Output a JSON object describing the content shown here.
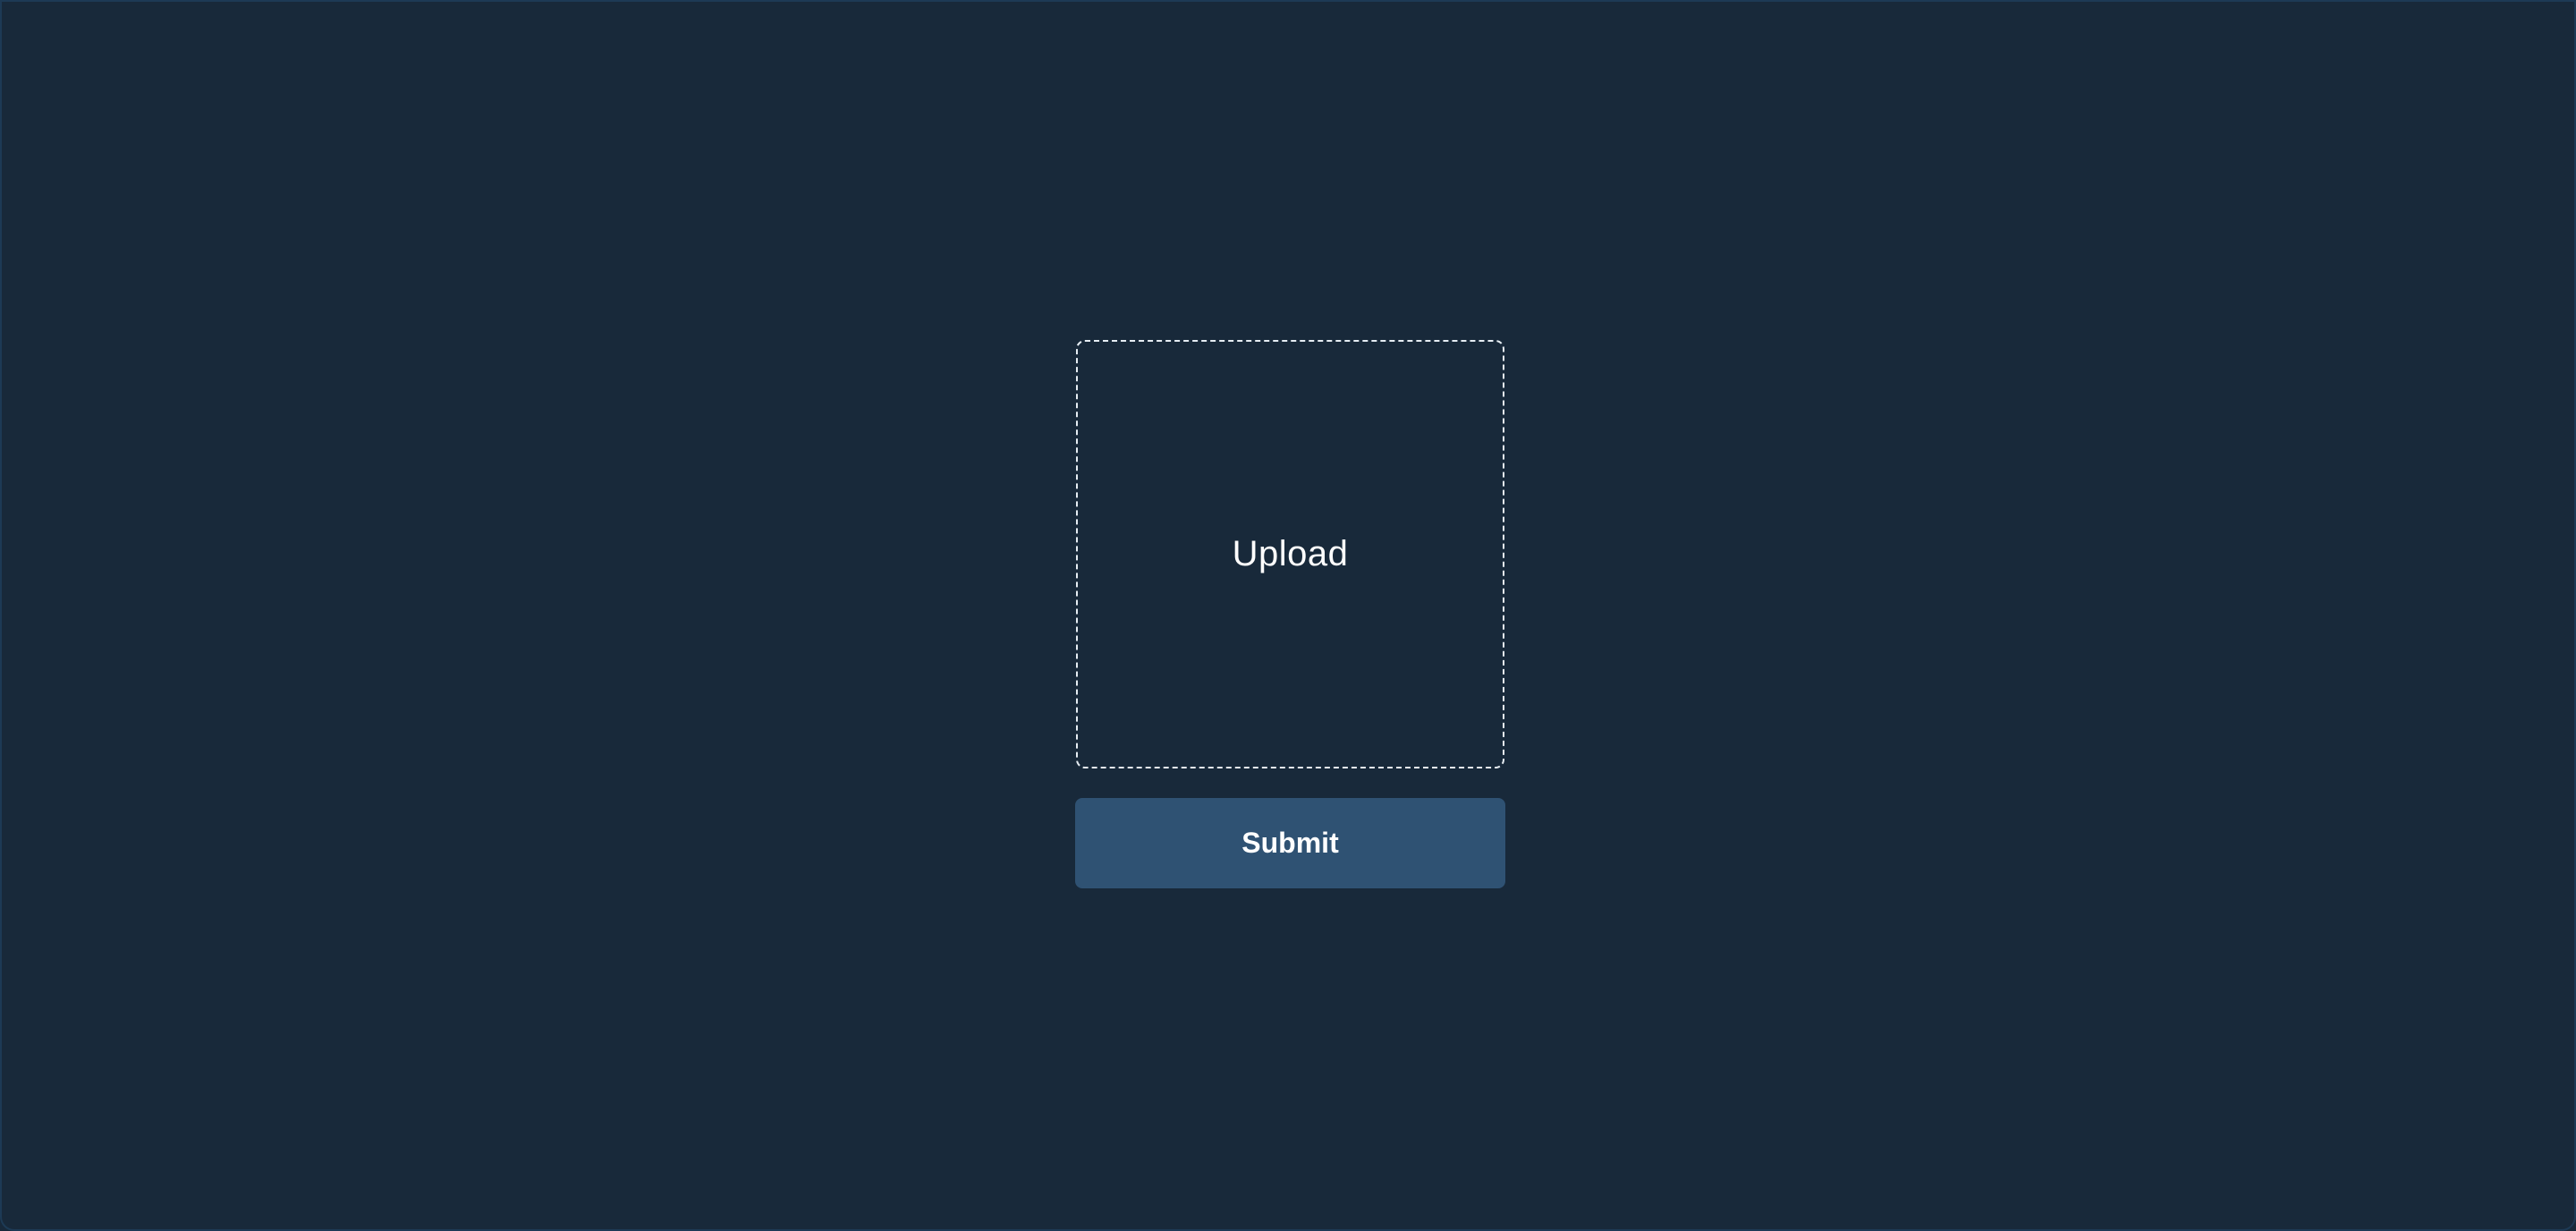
{
  "upload": {
    "label": "Upload"
  },
  "form": {
    "submit_label": "Submit"
  },
  "colors": {
    "background": "#18293a",
    "upload_border": "#e6edf3",
    "submit_background": "#2f5273",
    "text": "#ffffff"
  }
}
